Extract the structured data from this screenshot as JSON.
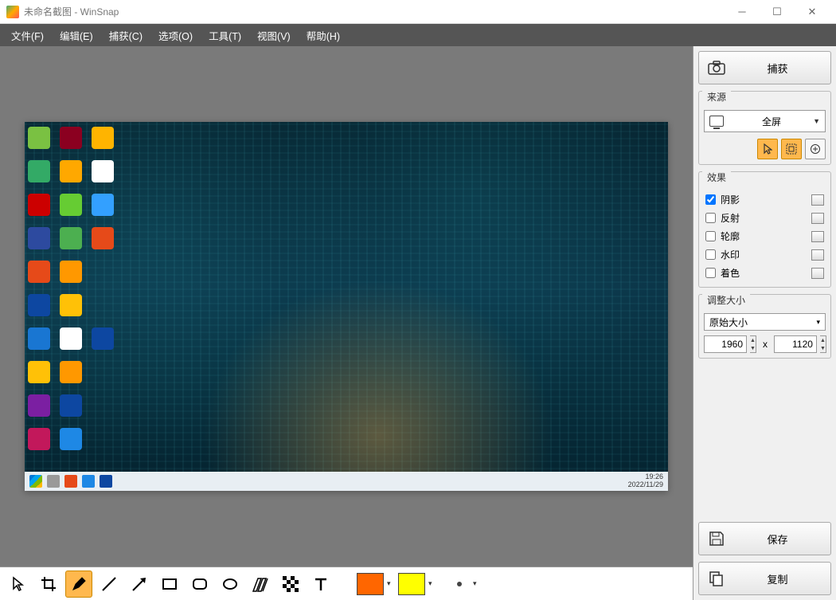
{
  "window": {
    "title": "未命名截图 - WinSnap"
  },
  "menubar": {
    "items": [
      "文件(F)",
      "编辑(E)",
      "捕获(C)",
      "选项(O)",
      "工具(T)",
      "视图(V)",
      "帮助(H)"
    ]
  },
  "sidebar": {
    "capture_label": "捕获",
    "source": {
      "title": "来源",
      "selected": "全屏"
    },
    "effects": {
      "title": "效果",
      "items": [
        {
          "label": "阴影",
          "checked": true
        },
        {
          "label": "反射",
          "checked": false
        },
        {
          "label": "轮廓",
          "checked": false
        },
        {
          "label": "水印",
          "checked": false
        },
        {
          "label": "着色",
          "checked": false
        }
      ]
    },
    "resize": {
      "title": "调整大小",
      "preset": "原始大小",
      "width": "1960",
      "height": "1120",
      "sep": "x"
    },
    "save_label": "保存",
    "copy_label": "复制"
  },
  "toolbar": {
    "colors": {
      "fill": "#ff6600",
      "stroke": "#ffff00"
    }
  },
  "canvas": {
    "taskbar_time": "19:26",
    "taskbar_date": "2022/11/29"
  }
}
